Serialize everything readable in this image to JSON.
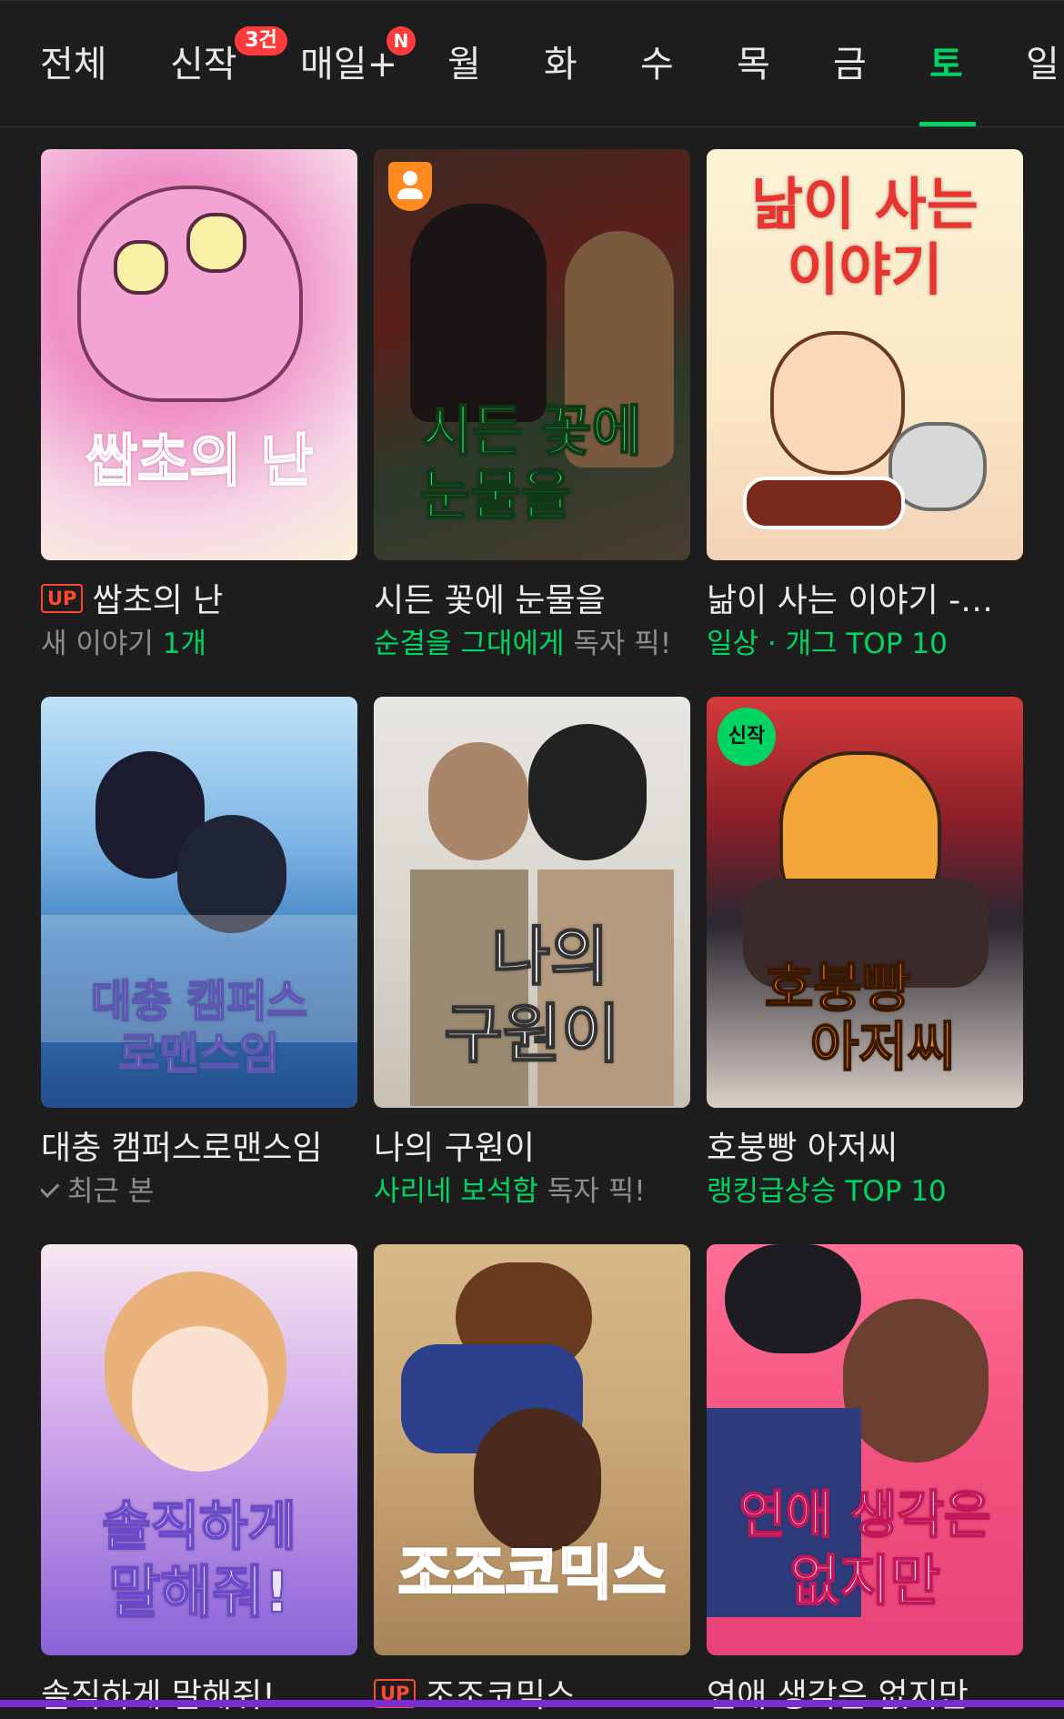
{
  "tabs": [
    {
      "label": "전체",
      "active": false
    },
    {
      "label": "신작",
      "active": false,
      "badge": "3건"
    },
    {
      "label": "매일+",
      "active": false,
      "badge": "N"
    },
    {
      "label": "월",
      "active": false
    },
    {
      "label": "화",
      "active": false
    },
    {
      "label": "수",
      "active": false
    },
    {
      "label": "목",
      "active": false
    },
    {
      "label": "금",
      "active": false
    },
    {
      "label": "토",
      "active": true
    },
    {
      "label": "일",
      "active": false
    }
  ],
  "colors": {
    "accent": "#00d564",
    "background": "#1d1d1d",
    "up_badge": "#ff4a2e",
    "tab_badge": "#ff3b3b"
  },
  "cards": [
    {
      "title": "쌉초의 난",
      "cover_text": "쌉초의 난",
      "up": "UP",
      "sub_plain": "새 이야기 ",
      "sub_green": "1개"
    },
    {
      "title": "시든 꽃에 눈물을",
      "cover_text_1": "시든 꽃에",
      "cover_text_2": "눈물을",
      "sub_green": "순결을 그대에게",
      "sub_plain": " 독자 픽!",
      "badge_icon": "person-icon"
    },
    {
      "title": "낢이 사는 이야기 -…",
      "cover_text_1": "낢이 사는",
      "cover_text_2": "이야기",
      "sub_green": "일상 · 개그 TOP 10"
    },
    {
      "title": "대충 캠퍼스로맨스임",
      "cover_text_1": "대충 캠퍼스",
      "cover_text_2": "로맨스임",
      "sub_plain": "최근 본",
      "sub_icon": "check-icon"
    },
    {
      "title": "나의 구원이",
      "cover_text_1": "나의",
      "cover_text_2": "구원이",
      "sub_green": "사리네 보석함",
      "sub_plain": " 독자 픽!"
    },
    {
      "title": "호붕빵 아저씨",
      "cover_text_1": "호붕빵",
      "cover_text_2": "아저씨",
      "new_badge": "신작",
      "sub_green": "랭킹급상승 TOP 10"
    },
    {
      "title": "솔직하게 말해줘!",
      "cover_text_1": "솔직하게",
      "cover_text_2": "말해줘!"
    },
    {
      "title": "조조코믹스",
      "cover_text": "조조코믹스",
      "up": "UP"
    },
    {
      "title": "연애 생각은 없지만",
      "cover_text_1": "연애 생각은",
      "cover_text_2": "없지만"
    }
  ]
}
